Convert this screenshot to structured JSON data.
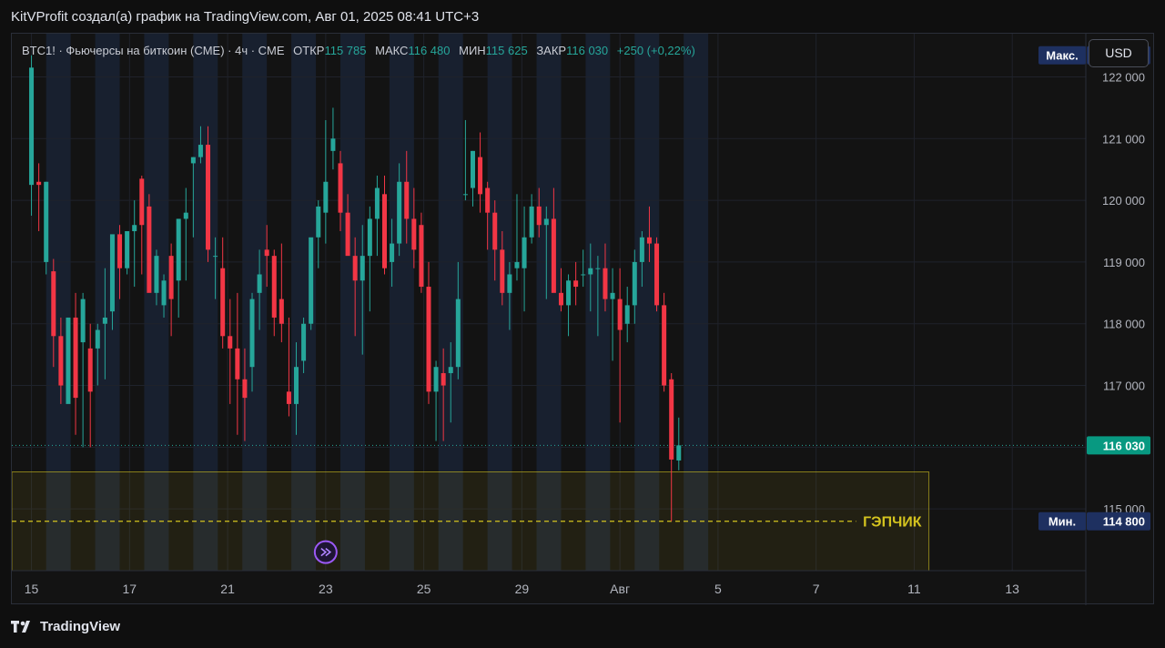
{
  "header": {
    "title": "KitVProfit создал(а) график на TradingView.com, Авг 01, 2025 08:41 UTC+3"
  },
  "legend": {
    "symbol": "BTC1! · Фьючерсы на биткоин (CME) · 4ч · CME",
    "open_label": "ОТКР",
    "open_value": "115 785",
    "high_label": "МАКС",
    "high_value": "116 480",
    "low_label": "МИН",
    "low_value": "115 625",
    "close_label": "ЗАКР",
    "close_value": "116 030",
    "change": "+250 (+0,22%)"
  },
  "currency_button": "USD",
  "footer": {
    "brand": "TradingView"
  },
  "colors": {
    "up": "#26a69a",
    "down": "#f23645",
    "zone": "#d4c31f",
    "session": "#1a2233",
    "max_badge": "#1e3060"
  },
  "chart_data": {
    "type": "candlestick",
    "title": "",
    "ylim": [
      114000,
      122700
    ],
    "y_ticks": [
      "115 000",
      "116 000",
      "117 000",
      "118 000",
      "119 000",
      "120 000",
      "121 000",
      "122 000"
    ],
    "y_tick_values": [
      115000,
      116000,
      117000,
      118000,
      119000,
      120000,
      121000,
      122000
    ],
    "x_ticks": [
      "15",
      "17",
      "21",
      "23",
      "25",
      "29",
      "Авг",
      "5",
      "7",
      "11",
      "13"
    ],
    "x_tick_values": [
      0,
      2,
      4,
      6,
      8,
      10,
      12,
      14,
      16,
      18,
      20
    ],
    "x_range": [
      -0.4,
      21.5
    ],
    "last_price_label": "116 030",
    "last_price": 116030,
    "max_label": "Макс.",
    "max_value": "122 350",
    "max_price": 122350,
    "min_label": "Мин.",
    "min_value": "114 800",
    "min_price": 114800,
    "zone": {
      "label": "ГЭПЧИК",
      "top": 115600,
      "bottom": 114000,
      "line": 114800,
      "x_end": 18.3
    },
    "candles": [
      [
        0,
        120250,
        122350,
        119750,
        122150
      ],
      [
        0.15,
        120300,
        120600,
        119500,
        120250
      ],
      [
        0.3,
        119000,
        120300,
        118800,
        120300
      ],
      [
        0.45,
        118850,
        119050,
        117300,
        117800
      ],
      [
        0.6,
        117800,
        118100,
        116700,
        117000
      ],
      [
        0.75,
        116700,
        118100,
        116800,
        118100
      ],
      [
        0.9,
        118100,
        118500,
        116200,
        116800
      ],
      [
        1.05,
        117700,
        118500,
        116000,
        118400
      ],
      [
        1.2,
        117600,
        118000,
        116000,
        116900
      ],
      [
        1.35,
        117600,
        118000,
        117000,
        117900
      ],
      [
        1.5,
        118000,
        118900,
        117100,
        118100
      ],
      [
        1.65,
        118200,
        119300,
        117900,
        119450
      ],
      [
        1.8,
        119450,
        119600,
        118400,
        118900
      ],
      [
        1.95,
        118900,
        119500,
        118800,
        119500
      ],
      [
        2.1,
        119500,
        120000,
        118600,
        119600
      ],
      [
        2.25,
        120350,
        120400,
        118800,
        119600
      ],
      [
        2.4,
        119900,
        120100,
        118600,
        118500
      ],
      [
        2.55,
        118500,
        119200,
        118300,
        119100
      ],
      [
        2.7,
        118300,
        118800,
        118100,
        118700
      ],
      [
        2.85,
        119100,
        119300,
        117800,
        118400
      ],
      [
        3.0,
        118700,
        119700,
        118100,
        119700
      ],
      [
        3.15,
        119700,
        120200,
        118700,
        119800
      ],
      [
        3.3,
        120600,
        120700,
        119400,
        120700
      ],
      [
        3.45,
        120700,
        121200,
        120600,
        120900
      ],
      [
        3.6,
        120900,
        121200,
        119000,
        119200
      ],
      [
        3.75,
        119100,
        119400,
        118400,
        119100
      ],
      [
        3.9,
        118900,
        119400,
        117600,
        117800
      ],
      [
        4.05,
        117800,
        118400,
        116700,
        117600
      ],
      [
        4.2,
        117600,
        118500,
        116200,
        117100
      ],
      [
        4.35,
        117100,
        117600,
        116100,
        116800
      ],
      [
        4.5,
        117300,
        118500,
        116900,
        118400
      ],
      [
        4.65,
        118500,
        119200,
        117900,
        118800
      ],
      [
        4.8,
        119200,
        119600,
        118600,
        119100
      ],
      [
        4.95,
        119100,
        119200,
        117800,
        118100
      ],
      [
        5.1,
        118400,
        119300,
        117700,
        118000
      ],
      [
        5.25,
        116900,
        118100,
        116500,
        116700
      ],
      [
        5.4,
        116700,
        117700,
        116200,
        117300
      ],
      [
        5.55,
        117400,
        118100,
        117200,
        118000
      ],
      [
        5.7,
        118000,
        119300,
        117900,
        119400
      ],
      [
        5.85,
        119400,
        120000,
        118900,
        119900
      ],
      [
        6.0,
        119800,
        121300,
        119300,
        120300
      ],
      [
        6.15,
        120800,
        121500,
        120500,
        121000
      ],
      [
        6.3,
        120600,
        120800,
        119500,
        119800
      ],
      [
        6.45,
        119800,
        120100,
        119200,
        119100
      ],
      [
        6.6,
        119100,
        119400,
        117800,
        118700
      ],
      [
        6.75,
        118700,
        119600,
        117500,
        119100
      ],
      [
        6.9,
        119100,
        119900,
        118200,
        119700
      ],
      [
        7.05,
        119700,
        120400,
        119100,
        120200
      ],
      [
        7.2,
        120100,
        120400,
        118800,
        118900
      ],
      [
        7.35,
        119000,
        119700,
        118600,
        119300
      ],
      [
        7.5,
        119300,
        120600,
        119100,
        120300
      ],
      [
        7.65,
        120300,
        120800,
        119300,
        119700
      ],
      [
        7.8,
        119700,
        120200,
        118900,
        119200
      ],
      [
        7.95,
        119600,
        119800,
        118500,
        118600
      ],
      [
        8.1,
        118600,
        119000,
        116700,
        116900
      ],
      [
        8.25,
        116900,
        117400,
        116100,
        117300
      ],
      [
        8.4,
        117200,
        117600,
        116100,
        117000
      ],
      [
        8.55,
        117200,
        117700,
        116400,
        117300
      ],
      [
        8.7,
        117300,
        119000,
        117100,
        118400
      ],
      [
        8.85,
        120100,
        121300,
        120000,
        120100
      ],
      [
        9.0,
        120200,
        120800,
        119900,
        120800
      ],
      [
        9.15,
        120700,
        121100,
        119800,
        120100
      ],
      [
        9.3,
        120200,
        120300,
        119200,
        119800
      ],
      [
        9.45,
        119800,
        120000,
        118700,
        119200
      ],
      [
        9.6,
        119200,
        119500,
        118300,
        118500
      ],
      [
        9.75,
        118500,
        119000,
        117900,
        118800
      ],
      [
        9.9,
        118900,
        120100,
        118700,
        119000
      ],
      [
        10.05,
        118900,
        119900,
        118200,
        119400
      ],
      [
        10.2,
        119400,
        120100,
        119300,
        119900
      ],
      [
        10.35,
        119900,
        120200,
        119400,
        119600
      ],
      [
        10.5,
        119600,
        119900,
        118400,
        119700
      ],
      [
        10.65,
        119700,
        120200,
        118800,
        118500
      ],
      [
        10.8,
        118500,
        118900,
        118200,
        118300
      ],
      [
        10.95,
        118300,
        118800,
        117800,
        118700
      ],
      [
        11.1,
        118700,
        119000,
        118300,
        118600
      ],
      [
        11.25,
        118800,
        119200,
        118600,
        118800
      ],
      [
        11.4,
        118800,
        119300,
        118200,
        118900
      ],
      [
        11.55,
        118900,
        119100,
        117800,
        118900
      ],
      [
        11.7,
        118900,
        119300,
        118200,
        118400
      ],
      [
        11.85,
        118400,
        118900,
        117400,
        118500
      ],
      [
        12.0,
        118400,
        118900,
        116400,
        117900
      ],
      [
        12.15,
        118000,
        118600,
        117700,
        118300
      ],
      [
        12.3,
        118300,
        119200,
        118000,
        119000
      ],
      [
        12.45,
        119000,
        119500,
        118600,
        119400
      ],
      [
        12.6,
        119400,
        119900,
        119000,
        119300
      ],
      [
        12.75,
        119300,
        119400,
        118200,
        118300
      ],
      [
        12.9,
        118300,
        118500,
        116900,
        117000
      ],
      [
        13.05,
        117100,
        117200,
        114800,
        115800
      ],
      [
        13.2,
        115785,
        116480,
        115625,
        116030
      ]
    ]
  }
}
